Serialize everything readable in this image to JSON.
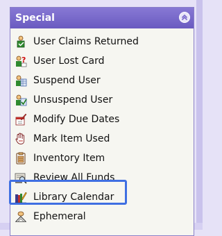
{
  "panel": {
    "title": "Special",
    "collapse_icon": "chevron-up-circle-icon"
  },
  "items": [
    {
      "label": "User Claims Returned",
      "icon": "user-claims-returned-icon"
    },
    {
      "label": "User Lost Card",
      "icon": "user-lost-card-icon"
    },
    {
      "label": "Suspend User",
      "icon": "suspend-user-icon"
    },
    {
      "label": "Unsuspend User",
      "icon": "unsuspend-user-icon"
    },
    {
      "label": "Modify Due Dates",
      "icon": "modify-due-dates-icon"
    },
    {
      "label": "Mark Item Used",
      "icon": "mark-item-used-icon"
    },
    {
      "label": "Inventory Item",
      "icon": "inventory-item-icon"
    },
    {
      "label": "Review All Funds",
      "icon": "review-all-funds-icon"
    },
    {
      "label": "Library Calendar",
      "icon": "library-calendar-icon",
      "highlighted": true
    },
    {
      "label": "Ephemeral",
      "icon": "ephemeral-icon"
    }
  ],
  "colors": {
    "header": "#7767cb",
    "panel_background": "#f6f6f1",
    "highlight_border": "#3f6fe2",
    "page_background": "#e6e2f7"
  }
}
